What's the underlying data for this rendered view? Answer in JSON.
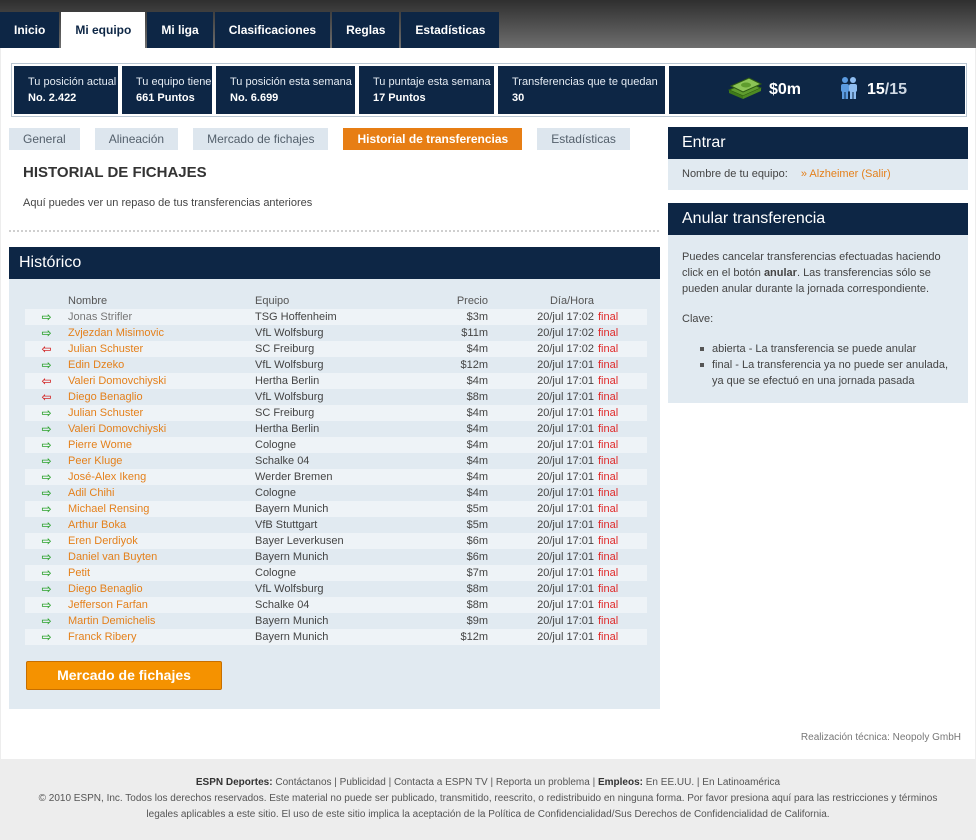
{
  "nav": {
    "tabs": [
      "Inicio",
      "Mi equipo",
      "Mi liga",
      "Clasificaciones",
      "Reglas",
      "Estadísticas"
    ],
    "active_index": 1
  },
  "stats": [
    {
      "label": "Tu posición actual",
      "value": "No. 2.422"
    },
    {
      "label": "Tu equipo tiene",
      "value": "661 Puntos"
    },
    {
      "label": "Tu posición esta semana",
      "value": "No. 6.699"
    },
    {
      "label": "Tu puntaje esta semana",
      "value": "17 Puntos"
    },
    {
      "label": "Transferencias que te quedan",
      "value": "30"
    }
  ],
  "budget": {
    "money": "$0m",
    "players_current": "15",
    "players_total": "/15"
  },
  "subtabs": [
    "General",
    "Alineación",
    "Mercado de fichajes",
    "Historial de transferencias",
    "Estadísticas"
  ],
  "subtab_active_index": 3,
  "page": {
    "title": "HISTORIAL DE FICHAJES",
    "description": "Aquí puedes ver un repaso de tus transferencias anteriores"
  },
  "historico": {
    "title": "Histórico",
    "columns": {
      "name": "Nombre",
      "team": "Equipo",
      "price": "Precio",
      "date": "Día/Hora"
    },
    "rows": [
      {
        "dir": "in",
        "name": "Jonas Strifler",
        "linked": false,
        "team": "TSG Hoffenheim",
        "price": "$3m",
        "date": "20/jul 17:02",
        "status": "final"
      },
      {
        "dir": "in",
        "name": "Zvjezdan Misimovic",
        "linked": true,
        "team": "VfL Wolfsburg",
        "price": "$11m",
        "date": "20/jul 17:02",
        "status": "final"
      },
      {
        "dir": "out",
        "name": "Julian Schuster",
        "linked": true,
        "team": "SC Freiburg",
        "price": "$4m",
        "date": "20/jul 17:02",
        "status": "final"
      },
      {
        "dir": "in",
        "name": "Edin Dzeko",
        "linked": true,
        "team": "VfL Wolfsburg",
        "price": "$12m",
        "date": "20/jul 17:01",
        "status": "final"
      },
      {
        "dir": "out",
        "name": "Valeri Domovchiyski",
        "linked": true,
        "team": "Hertha Berlin",
        "price": "$4m",
        "date": "20/jul 17:01",
        "status": "final"
      },
      {
        "dir": "out",
        "name": "Diego Benaglio",
        "linked": true,
        "team": "VfL Wolfsburg",
        "price": "$8m",
        "date": "20/jul 17:01",
        "status": "final"
      },
      {
        "dir": "in",
        "name": "Julian Schuster",
        "linked": true,
        "team": "SC Freiburg",
        "price": "$4m",
        "date": "20/jul 17:01",
        "status": "final"
      },
      {
        "dir": "in",
        "name": "Valeri Domovchiyski",
        "linked": true,
        "team": "Hertha Berlin",
        "price": "$4m",
        "date": "20/jul 17:01",
        "status": "final"
      },
      {
        "dir": "in",
        "name": "Pierre Wome",
        "linked": true,
        "team": "Cologne",
        "price": "$4m",
        "date": "20/jul 17:01",
        "status": "final"
      },
      {
        "dir": "in",
        "name": "Peer Kluge",
        "linked": true,
        "team": "Schalke 04",
        "price": "$4m",
        "date": "20/jul 17:01",
        "status": "final"
      },
      {
        "dir": "in",
        "name": "José-Alex Ikeng",
        "linked": true,
        "team": "Werder Bremen",
        "price": "$4m",
        "date": "20/jul 17:01",
        "status": "final"
      },
      {
        "dir": "in",
        "name": "Adil Chihi",
        "linked": true,
        "team": "Cologne",
        "price": "$4m",
        "date": "20/jul 17:01",
        "status": "final"
      },
      {
        "dir": "in",
        "name": "Michael Rensing",
        "linked": true,
        "team": "Bayern Munich",
        "price": "$5m",
        "date": "20/jul 17:01",
        "status": "final"
      },
      {
        "dir": "in",
        "name": "Arthur Boka",
        "linked": true,
        "team": "VfB Stuttgart",
        "price": "$5m",
        "date": "20/jul 17:01",
        "status": "final"
      },
      {
        "dir": "in",
        "name": "Eren Derdiyok",
        "linked": true,
        "team": "Bayer Leverkusen",
        "price": "$6m",
        "date": "20/jul 17:01",
        "status": "final"
      },
      {
        "dir": "in",
        "name": "Daniel van Buyten",
        "linked": true,
        "team": "Bayern Munich",
        "price": "$6m",
        "date": "20/jul 17:01",
        "status": "final"
      },
      {
        "dir": "in",
        "name": "Petit",
        "linked": true,
        "team": "Cologne",
        "price": "$7m",
        "date": "20/jul 17:01",
        "status": "final"
      },
      {
        "dir": "in",
        "name": "Diego Benaglio",
        "linked": true,
        "team": "VfL Wolfsburg",
        "price": "$8m",
        "date": "20/jul 17:01",
        "status": "final"
      },
      {
        "dir": "in",
        "name": "Jefferson Farfan",
        "linked": true,
        "team": "Schalke 04",
        "price": "$8m",
        "date": "20/jul 17:01",
        "status": "final"
      },
      {
        "dir": "in",
        "name": "Martin Demichelis",
        "linked": true,
        "team": "Bayern Munich",
        "price": "$9m",
        "date": "20/jul 17:01",
        "status": "final"
      },
      {
        "dir": "in",
        "name": "Franck Ribery",
        "linked": true,
        "team": "Bayern Munich",
        "price": "$12m",
        "date": "20/jul 17:01",
        "status": "final"
      }
    ],
    "button_label": "Mercado de fichajes"
  },
  "entrar": {
    "title": "Entrar",
    "label": "Nombre de tu equipo:",
    "link": "» Alzheimer (Salir)"
  },
  "anular": {
    "title": "Anular transferencia",
    "text_before": "Puedes cancelar transferencias efectuadas haciendo click en el botón ",
    "text_bold": "anular",
    "text_after": ". Las transferencias sólo se pueden anular durante la jornada correspondiente.",
    "clave_label": "Clave:",
    "clave_items": [
      "abierta - La transferencia se puede anular",
      "final - La transferencia ya no puede ser anulada, ya que se efectuó en una jornada pasada"
    ]
  },
  "credit": "Realización técnica: Neopoly GmbH",
  "footer": {
    "brand": "ESPN Deportes:",
    "links": "Contáctanos | Publicidad | Contacta a ESPN TV | Reporta un problema |",
    "jobs_label": "Empleos:",
    "jobs_links": "En EE.UU. | En Latinoamérica",
    "legal": "© 2010 ESPN, Inc. Todos los derechos reservados. Este material no puede ser publicado, transmitido, reescrito, o redistribuido en ninguna forma. Por favor presiona aquí para las restricciones y términos legales aplicables a este sitio. El uso de este sitio implica la aceptación de la Política de Confidencialidad/Sus Derechos de Confidencialidad de California."
  },
  "colors": {
    "navy": "#0d2645",
    "orange": "#e77e14",
    "button": "#f59200",
    "panel": "#e1eaf1"
  }
}
